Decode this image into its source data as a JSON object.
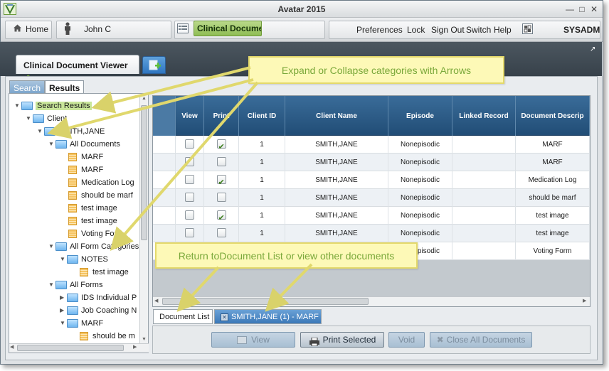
{
  "window": {
    "title": "Avatar 2015"
  },
  "toolbar": {
    "home_label": "Home",
    "user_name": "John C",
    "active_form": "Clinical Docume",
    "menu": [
      "Preferences",
      "Lock",
      "Sign Out",
      "Switch",
      "Help"
    ],
    "system_user": "SYSADM"
  },
  "viewer": {
    "tab_title": "Clinical Document Viewer"
  },
  "side_tabs": {
    "search": "Search",
    "results": "Results"
  },
  "tree": [
    {
      "label": "Search Results",
      "level": 0,
      "icon": "folder",
      "toggle": "open",
      "highlight": true
    },
    {
      "label": "Client",
      "level": 1,
      "icon": "folder",
      "toggle": "open"
    },
    {
      "label": "SMITH,JANE",
      "level": 2,
      "icon": "folder",
      "toggle": "open"
    },
    {
      "label": "All Documents",
      "level": 3,
      "icon": "folder",
      "toggle": "open"
    },
    {
      "label": "MARF",
      "level": 4,
      "icon": "doc"
    },
    {
      "label": "MARF",
      "level": 4,
      "icon": "doc"
    },
    {
      "label": "Medication Log",
      "level": 4,
      "icon": "doc"
    },
    {
      "label": "should be marf",
      "level": 4,
      "icon": "doc"
    },
    {
      "label": "test image",
      "level": 4,
      "icon": "doc"
    },
    {
      "label": "test image",
      "level": 4,
      "icon": "doc"
    },
    {
      "label": "Voting Form",
      "level": 4,
      "icon": "doc"
    },
    {
      "label": "All Form Categories",
      "level": 3,
      "icon": "folder",
      "toggle": "open"
    },
    {
      "label": "NOTES",
      "level": 4,
      "icon": "folder",
      "toggle": "open"
    },
    {
      "label": "test image",
      "level": 5,
      "icon": "doc"
    },
    {
      "label": "All Forms",
      "level": 3,
      "icon": "folder",
      "toggle": "open"
    },
    {
      "label": "IDS Individual P",
      "level": 4,
      "icon": "folder",
      "toggle": "closed"
    },
    {
      "label": "Job Coaching N",
      "level": 4,
      "icon": "folder",
      "toggle": "closed"
    },
    {
      "label": "MARF",
      "level": 4,
      "icon": "folder",
      "toggle": "open"
    },
    {
      "label": "should be m",
      "level": 5,
      "icon": "doc"
    }
  ],
  "grid": {
    "columns": [
      "",
      "View",
      "Print",
      "Client ID",
      "Client Name",
      "Episode",
      "Linked Record",
      "Document Descrip"
    ],
    "rows": [
      {
        "view": false,
        "print": true,
        "client_id": "1",
        "client_name": "SMITH,JANE",
        "episode": "Nonepisodic",
        "linked": "",
        "desc": "MARF"
      },
      {
        "view": false,
        "print": false,
        "client_id": "1",
        "client_name": "SMITH,JANE",
        "episode": "Nonepisodic",
        "linked": "",
        "desc": "MARF"
      },
      {
        "view": false,
        "print": true,
        "client_id": "1",
        "client_name": "SMITH,JANE",
        "episode": "Nonepisodic",
        "linked": "",
        "desc": "Medication Log"
      },
      {
        "view": false,
        "print": false,
        "client_id": "1",
        "client_name": "SMITH,JANE",
        "episode": "Nonepisodic",
        "linked": "",
        "desc": "should be marf"
      },
      {
        "view": false,
        "print": true,
        "client_id": "1",
        "client_name": "SMITH,JANE",
        "episode": "Nonepisodic",
        "linked": "",
        "desc": "test image"
      },
      {
        "view": false,
        "print": false,
        "client_id": "1",
        "client_name": "SMITH,JANE",
        "episode": "Nonepisodic",
        "linked": "",
        "desc": "test image"
      },
      {
        "view": false,
        "print": false,
        "client_id": "1",
        "client_name": "SMITH,JANE",
        "episode": "Nonepisodic",
        "linked": "",
        "desc": "Voting Form"
      }
    ]
  },
  "bottom_tabs": {
    "doc_list": "Document List",
    "open_doc": "SMITH,JANE (1) - MARF"
  },
  "buttons": {
    "view": "View",
    "print_selected": "Print Selected",
    "void": "Void",
    "close_all": "Close All Documents"
  },
  "callouts": {
    "expand": "Expand or Collapse categories with Arrows",
    "return": "Return toDocument List or view other documents"
  },
  "colors": {
    "accent_blue": "#2c5f8f",
    "active_green": "#8fbd55",
    "callout_text": "#7aa83a",
    "callout_bg": "#fdf9b7"
  }
}
